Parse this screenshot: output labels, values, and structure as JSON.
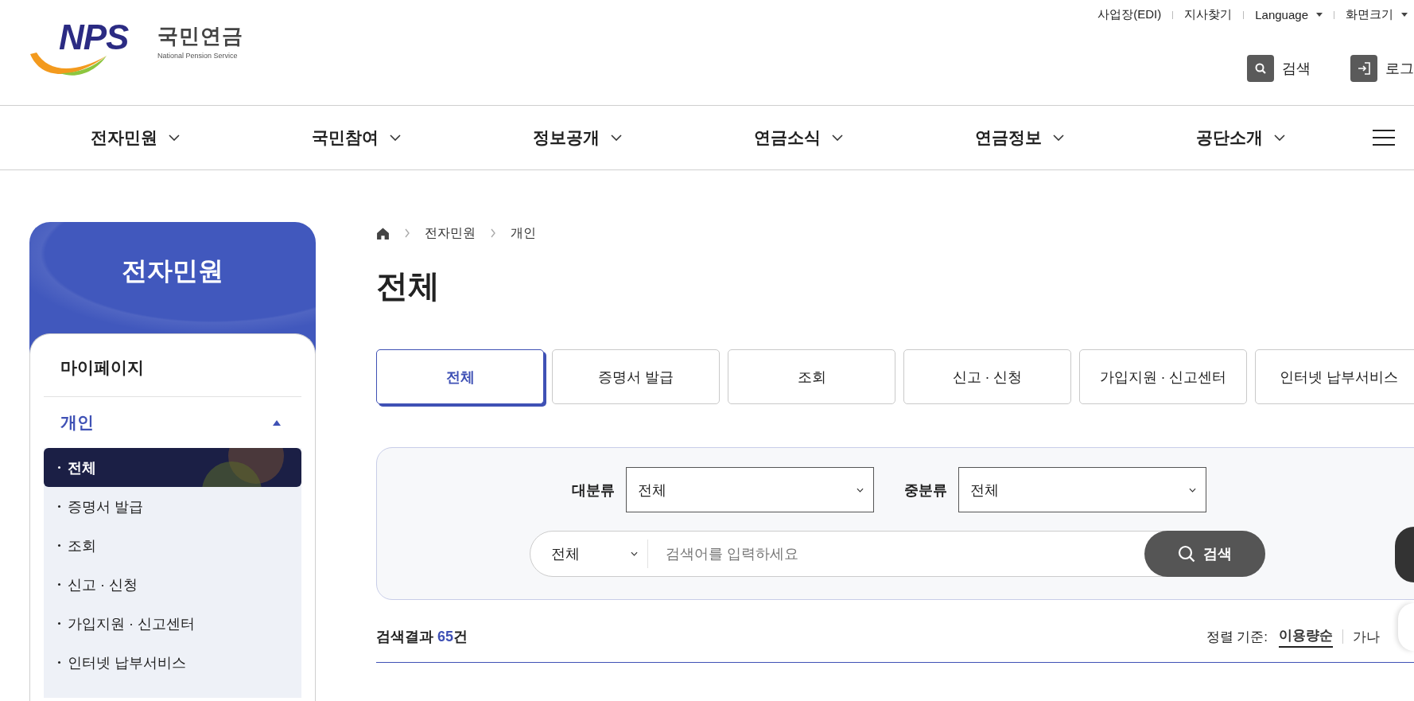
{
  "logo": {
    "mark": "NPS",
    "name": "국민연금",
    "subtitle": "National Pension Service"
  },
  "utility_links": [
    {
      "label": "사업장(EDI)",
      "dropdown": false
    },
    {
      "label": "지사찾기",
      "dropdown": false
    },
    {
      "label": "Language",
      "dropdown": true
    },
    {
      "label": "화면크기",
      "dropdown": true
    }
  ],
  "header_buttons": [
    {
      "label": "검색",
      "kind": "search"
    },
    {
      "label": "로그",
      "kind": "login"
    }
  ],
  "nav": [
    {
      "label": "전자민원"
    },
    {
      "label": "국민참여"
    },
    {
      "label": "정보공개"
    },
    {
      "label": "연금소식"
    },
    {
      "label": "연금정보"
    },
    {
      "label": "공단소개"
    }
  ],
  "sidebar": {
    "title": "전자민원",
    "sections": [
      {
        "label": "마이페이지",
        "kind": "link",
        "selected": false
      },
      {
        "label": "개인",
        "kind": "group",
        "selected": true,
        "expanded": true,
        "children": [
          {
            "label": "전체",
            "selected": true
          },
          {
            "label": "증명서 발급",
            "selected": false
          },
          {
            "label": "조회",
            "selected": false
          },
          {
            "label": "신고 · 신청",
            "selected": false
          },
          {
            "label": "가입지원 · 신고센터",
            "selected": false
          },
          {
            "label": "인터넷 납부서비스",
            "selected": false
          }
        ]
      }
    ]
  },
  "breadcrumb": [
    "전자민원",
    "개인"
  ],
  "page_title": "전체",
  "tabs": [
    {
      "label": "전체",
      "selected": true
    },
    {
      "label": "증명서 발급",
      "selected": false
    },
    {
      "label": "조회",
      "selected": false
    },
    {
      "label": "신고 · 신청",
      "selected": false
    },
    {
      "label": "가입지원 · 신고센터",
      "selected": false
    },
    {
      "label": "인터넷 납부서비스",
      "selected": false
    }
  ],
  "filters": [
    {
      "label": "대분류",
      "value": "전체"
    },
    {
      "label": "중분류",
      "value": "전체"
    }
  ],
  "search": {
    "scope": "전체",
    "placeholder": "검색어를 입력하세요",
    "button": "검색"
  },
  "results": {
    "label": "검색결과",
    "count": "65",
    "unit": "건"
  },
  "sort": {
    "label": "정렬 기준:",
    "options": [
      {
        "label": "이용량순",
        "selected": true
      },
      {
        "label": "가나",
        "selected": false
      }
    ]
  }
}
